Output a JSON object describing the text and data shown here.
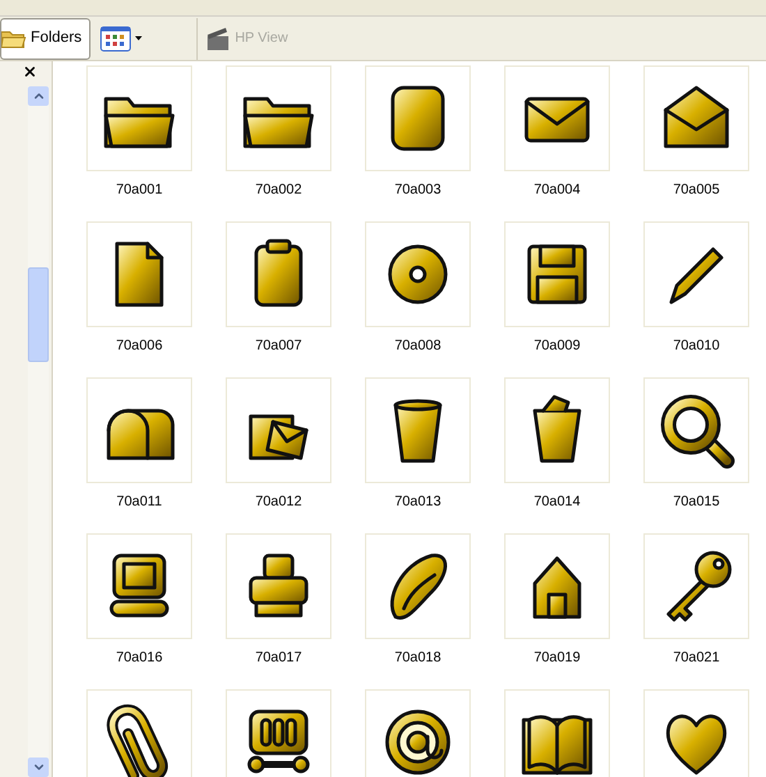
{
  "toolbar": {
    "folders_button": {
      "label": "Folders",
      "selected": true
    },
    "hp_view_button": {
      "label": "HP View",
      "disabled": true
    }
  },
  "thumbnails": [
    {
      "label": "70a001"
    },
    {
      "label": "70a002"
    },
    {
      "label": "70a003"
    },
    {
      "label": "70a004"
    },
    {
      "label": "70a005"
    },
    {
      "label": "70a006"
    },
    {
      "label": "70a007"
    },
    {
      "label": "70a008"
    },
    {
      "label": "70a009"
    },
    {
      "label": "70a010"
    },
    {
      "label": "70a011"
    },
    {
      "label": "70a012"
    },
    {
      "label": "70a013"
    },
    {
      "label": "70a014"
    },
    {
      "label": "70a015"
    },
    {
      "label": "70a016"
    },
    {
      "label": "70a017"
    },
    {
      "label": "70a018"
    },
    {
      "label": "70a019"
    },
    {
      "label": "70a021"
    }
  ]
}
